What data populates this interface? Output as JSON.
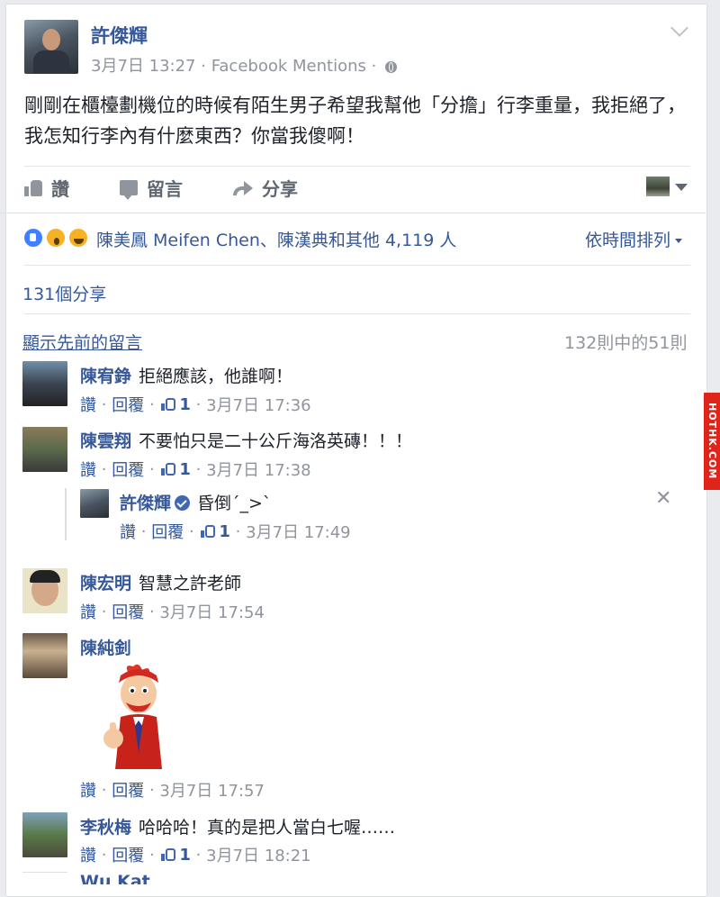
{
  "post": {
    "author": "許傑輝",
    "date": "3月7日 13:27",
    "sep": "·",
    "source": "Facebook Mentions",
    "text": "剛剛在櫃檯劃機位的時候有陌生男子希望我幫他「分擔」行李重量，我拒絕了，我怎知行李內有什麼東西？你當我傻啊！"
  },
  "actions": {
    "like": "讚",
    "comment": "留言",
    "share": "分享"
  },
  "reactions": {
    "summary": "陳美鳳 Meifen Chen、陳漢典和其他 4,119 人",
    "sort_label": "依時間排列",
    "shares": "131個分享",
    "view_previous": "顯示先前的留言",
    "count": "132則中的51則"
  },
  "meta_labels": {
    "like": "讚",
    "reply": "回覆",
    "dot": "·"
  },
  "comments": [
    {
      "name": "陳宥錚",
      "text": "拒絕應該，他誰啊！",
      "likes": "1",
      "time": "3月7日 17:36"
    },
    {
      "name": "陳雲翔",
      "text": "不要怕只是二十公斤海洛英磚！！！",
      "likes": "1",
      "time": "3月7日 17:38"
    },
    {
      "name": "許傑輝",
      "text": "昏倒´_>`",
      "likes": "1",
      "time": "3月7日 17:49"
    },
    {
      "name": "陳宏明",
      "text": "智慧之許老師",
      "time": "3月7日 17:54"
    },
    {
      "name": "陳純釗",
      "text": "",
      "time": "3月7日 17:57"
    },
    {
      "name": "李秋梅",
      "text": "哈哈哈！真的是把人當白七喔……",
      "likes": "1",
      "time": "3月7日 18:21"
    },
    {
      "name": "Wu Kat"
    }
  ],
  "watermark": "HOTHK.COM"
}
